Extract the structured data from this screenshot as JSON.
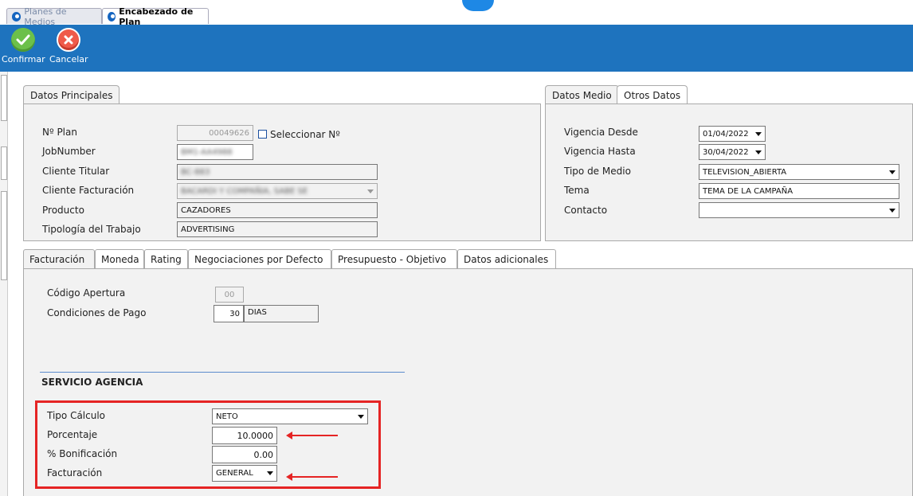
{
  "window_tabs": [
    {
      "label": "Planes de Medios",
      "active": false
    },
    {
      "label": "Encabezado de Plan",
      "active": true
    }
  ],
  "toolbar": {
    "confirm_label": "Confirmar",
    "cancel_label": "Cancelar",
    "confirm_icon": "check-icon",
    "cancel_icon": "close-icon"
  },
  "main_panel": {
    "tab": "Datos Principales",
    "fields": {
      "plan_label": "Nº Plan",
      "plan_value": "00049626",
      "select_number_label": "Seleccionar Nº",
      "jobnumber_label": "JobNumber",
      "jobnumber_value": "BM1-AA4988",
      "cliente_titular_label": "Cliente Titular",
      "cliente_titular_value": "BC-883",
      "cliente_facturacion_label": "Cliente Facturación",
      "cliente_facturacion_value": "BACARDI Y COMPAÑIA, SABE SE",
      "producto_label": "Producto",
      "producto_value": "CAZADORES",
      "tipologia_label": "Tipología del Trabajo",
      "tipologia_value": "ADVERTISING"
    }
  },
  "media_panel": {
    "tabs": [
      "Datos Medio",
      "Otros Datos"
    ],
    "vigencia_desde_label": "Vigencia Desde",
    "vigencia_desde_value": "01/04/2022",
    "vigencia_hasta_label": "Vigencia Hasta",
    "vigencia_hasta_value": "30/04/2022",
    "tipo_medio_label": "Tipo de Medio",
    "tipo_medio_value": "TELEVISION_ABIERTA",
    "tema_label": "Tema",
    "tema_value": "TEMA DE LA CAMPAÑA",
    "contacto_label": "Contacto",
    "contacto_value": ""
  },
  "sub_tabs": [
    "Facturación",
    "Moneda",
    "Rating",
    "Negociaciones por Defecto",
    "Presupuesto - Objetivo",
    "Datos adicionales"
  ],
  "facturacion": {
    "codigo_apertura_label": "Código Apertura",
    "codigo_apertura_value": "00",
    "condiciones_pago_label": "Condiciones de Pago",
    "condiciones_pago_days": "30",
    "condiciones_pago_unit": "DIAS",
    "servicio_agencia_title": "SERVICIO AGENCIA",
    "tipo_calculo_label": "Tipo Cálculo",
    "tipo_calculo_value": "NETO",
    "porcentaje_label": "Porcentaje",
    "porcentaje_value": "10.0000",
    "bonificacion_label": "% Bonificación",
    "bonificacion_value": "0.00",
    "facturacion_label": "Facturación",
    "facturacion_value": "GENERAL"
  },
  "colors": {
    "toolbar": "#1e73be",
    "highlight": "#e52424",
    "confirm": "#6cc04a",
    "cancel": "#ef5a4a"
  }
}
